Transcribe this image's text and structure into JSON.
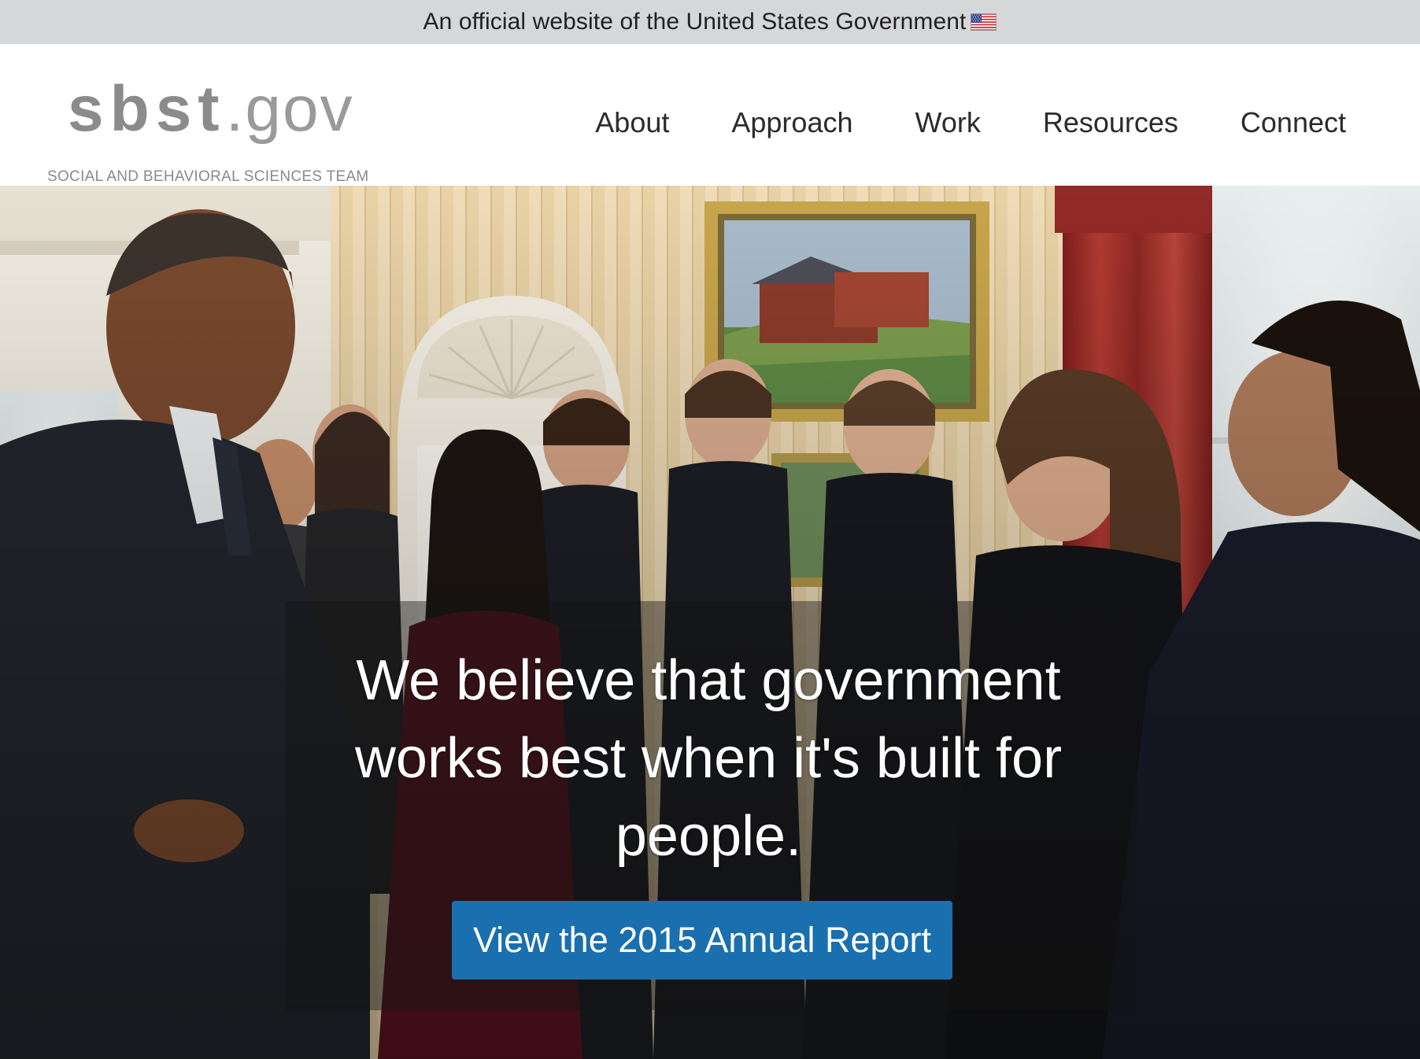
{
  "gov_banner": {
    "text": "An official website of the United States Government",
    "flag_icon": "us-flag-icon"
  },
  "header": {
    "logo": {
      "name_bold": "sbst",
      "name_suffix": ".gov",
      "tagline": "SOCIAL AND BEHAVIORAL SCIENCES TEAM"
    },
    "nav": [
      {
        "label": "About"
      },
      {
        "label": "Approach"
      },
      {
        "label": "Work"
      },
      {
        "label": "Resources"
      },
      {
        "label": "Connect"
      }
    ]
  },
  "hero": {
    "heading": "We believe that government works best when it's built for people.",
    "cta_label": "View the 2015 Annual Report",
    "overlay_color": "#121212",
    "cta_color": "#1a6fae"
  }
}
